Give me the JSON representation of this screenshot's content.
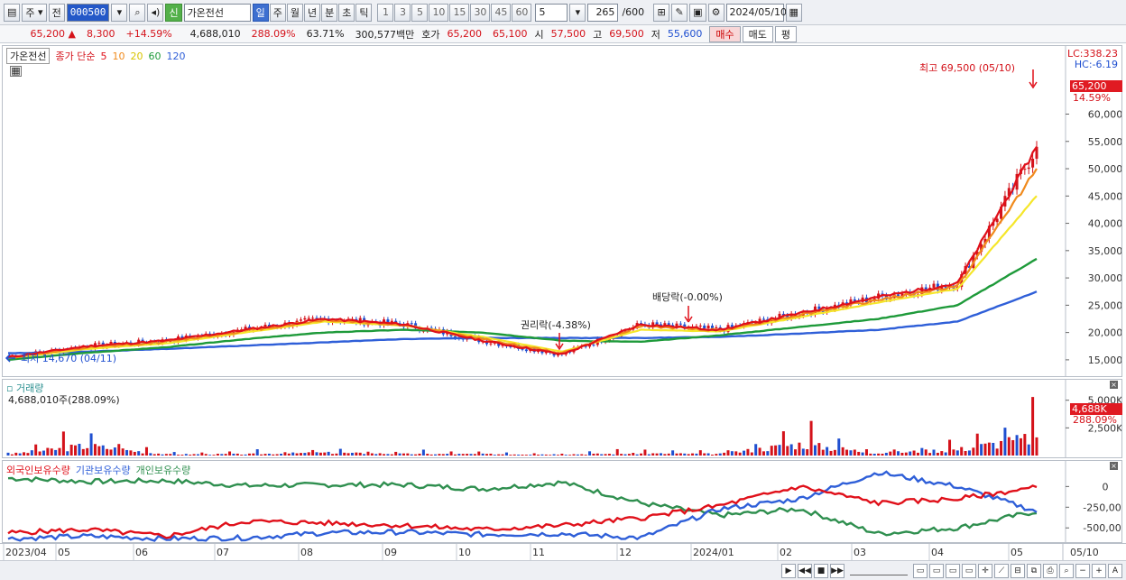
{
  "toolbar": {
    "type_label": "주",
    "market_label": "전",
    "code_value": "000500",
    "new_badge": "신",
    "stock_name": "가온전선",
    "periods": [
      "일",
      "주",
      "월",
      "년",
      "분",
      "초",
      "틱"
    ],
    "active_period": "일",
    "intervals": [
      "1",
      "3",
      "5",
      "10",
      "15",
      "30",
      "45",
      "60"
    ],
    "interval_value": "5",
    "count_value": "265",
    "count_total": "/600",
    "date_value": "2024/05/10"
  },
  "quote": {
    "price": "65,200",
    "change": "8,300",
    "change_pct": "+14.59%",
    "volume": "4,688,010",
    "volume_ratio": "288.09%",
    "ratio2": "63.71%",
    "amount": "300,577백만",
    "ask_label": "호가",
    "ask1": "65,200",
    "ask2": "65,100",
    "open_label": "시",
    "open": "57,500",
    "high_label": "고",
    "high": "69,500",
    "low_label": "저",
    "low": "55,600",
    "buy_label": "매수",
    "sell_label": "매도",
    "eval_label": "평"
  },
  "price_panel": {
    "name_label": "가온전선",
    "ma_title": "종가 단순",
    "ma_periods": [
      "5",
      "10",
      "20",
      "60",
      "120"
    ],
    "lc_label": "LC:338.23",
    "hc_label": "HC:-6.19",
    "high_annotation": "최고 69,500 (05/10)",
    "low_annotation": "최저 14,670 (04/11)",
    "rights_annotation": "권리락(-4.38%)",
    "dividend_annotation": "배당락(-0.00%)",
    "current_price_tag": "65,200",
    "current_pct_tag": "14.59%",
    "y_ticks": [
      "60,000",
      "55,000",
      "50,000",
      "45,000",
      "40,000",
      "35,000",
      "30,000",
      "25,000",
      "20,000",
      "15,000"
    ]
  },
  "volume_panel": {
    "title": "거래량",
    "summary": "4,688,010주(288.09%)",
    "current_tag": "4,688K",
    "pct_tag": "288.09%",
    "y_ticks": [
      "5,000K",
      "2,500K"
    ]
  },
  "holding_panel": {
    "series_labels": [
      "외국인보유수량",
      "기관보유수량",
      "개인보유수량"
    ],
    "y_ticks": [
      "0",
      "-250,000",
      "-500,000"
    ]
  },
  "x_axis": {
    "labels": [
      "2023/04",
      "05",
      "06",
      "07",
      "08",
      "09",
      "10",
      "11",
      "12",
      "2024/01",
      "02",
      "03",
      "04",
      "05"
    ],
    "end_label": "05/10"
  },
  "colors": {
    "up": "#d4121a",
    "down": "#1f4fd0",
    "ma5": "#e0101a",
    "ma10": "#f08a1c",
    "ma20": "#f5e62a",
    "ma60": "#1e9a3a",
    "ma120": "#2f5fd8",
    "foreign": "#e0101a",
    "institution": "#2f5fd8",
    "individual": "#2f8f4f"
  },
  "chart_data": [
    {
      "type": "candlestick-line",
      "title": "가온전선",
      "x": [
        "2023/04",
        "05",
        "06",
        "07",
        "08",
        "09",
        "10",
        "11",
        "12",
        "2024/01",
        "02",
        "03",
        "04",
        "05/10"
      ],
      "series": [
        {
          "name": "5",
          "values": [
            15500,
            17500,
            18500,
            20500,
            22500,
            21500,
            18500,
            16000,
            21500,
            20500,
            23500,
            26500,
            29000,
            54000
          ]
        },
        {
          "name": "10",
          "values": [
            15400,
            17200,
            18300,
            20300,
            22300,
            21400,
            18800,
            16200,
            21200,
            20400,
            23200,
            26000,
            28500,
            50000
          ]
        },
        {
          "name": "20",
          "values": [
            15300,
            17000,
            18000,
            20000,
            22000,
            21300,
            19200,
            16500,
            20500,
            20200,
            22800,
            25500,
            28000,
            45000
          ]
        },
        {
          "name": "60",
          "values": [
            15000,
            16300,
            17300,
            18800,
            20000,
            20500,
            20000,
            18500,
            18300,
            19500,
            21000,
            22500,
            25000,
            33500
          ]
        },
        {
          "name": "120",
          "values": [
            16200,
            16500,
            17000,
            17600,
            18200,
            18800,
            19000,
            19000,
            19000,
            19200,
            19800,
            20500,
            22000,
            27500
          ]
        }
      ],
      "ylim": [
        13000,
        69500
      ]
    },
    {
      "type": "bar",
      "title": "거래량",
      "x": [
        "2023/04",
        "05",
        "06",
        "07",
        "08",
        "09",
        "10",
        "11",
        "12",
        "2024/01",
        "02",
        "03",
        "04",
        "05/10"
      ],
      "values": [
        300,
        2500,
        300,
        350,
        700,
        400,
        350,
        300,
        500,
        400,
        2900,
        600,
        1500,
        4688
      ],
      "ylim": [
        0,
        6200
      ]
    },
    {
      "type": "line",
      "x": [
        "2023/04",
        "05",
        "06",
        "07",
        "08",
        "09",
        "10",
        "11",
        "12",
        "2024/01",
        "02",
        "03",
        "04",
        "05/10"
      ],
      "series": [
        {
          "name": "외국인보유수량",
          "values": [
            -560000,
            -520000,
            -600000,
            -420000,
            -440000,
            -470000,
            -520000,
            -470000,
            -380000,
            -230000,
            0,
            -200000,
            -150000,
            -10000
          ]
        },
        {
          "name": "기관보유수량",
          "values": [
            -630000,
            -600000,
            -630000,
            -620000,
            -560000,
            -550000,
            -580000,
            -570000,
            -620000,
            -270000,
            -150000,
            170000,
            0,
            -300000
          ]
        },
        {
          "name": "개인보유수량",
          "values": [
            100000,
            60000,
            70000,
            10000,
            20000,
            20000,
            -30000,
            50000,
            -200000,
            -350000,
            -270000,
            -570000,
            -500000,
            -300000
          ]
        }
      ],
      "ylim": [
        -650000,
        200000
      ]
    }
  ]
}
